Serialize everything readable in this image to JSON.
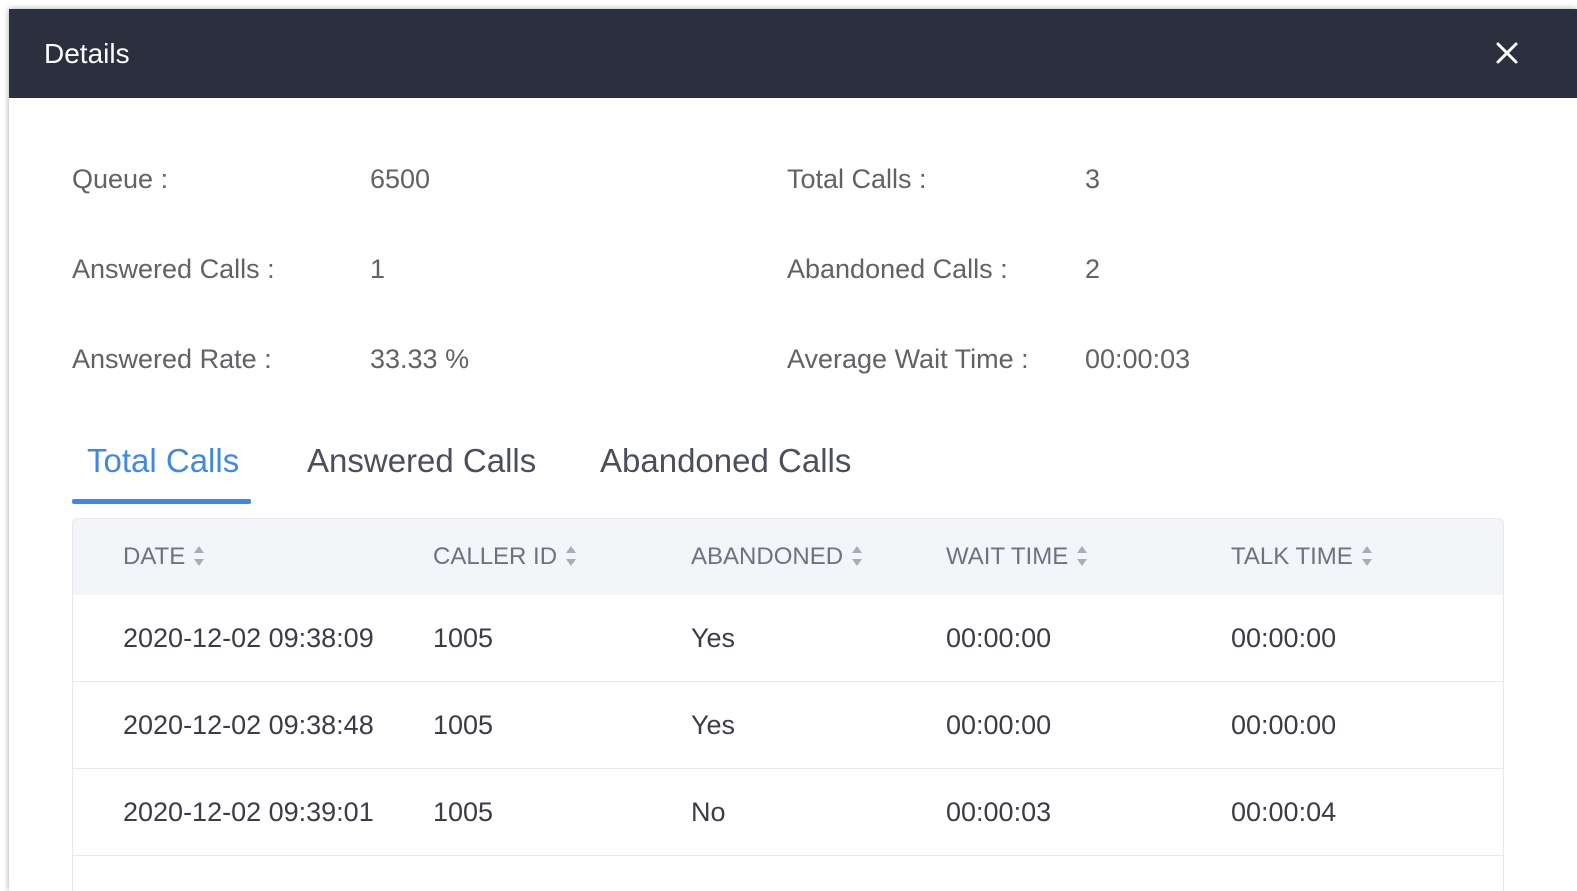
{
  "dialog": {
    "title": "Details",
    "close_icon": "close-icon"
  },
  "summary": {
    "queue_label": "Queue :",
    "queue_value": "6500",
    "total_calls_label": "Total Calls :",
    "total_calls_value": "3",
    "answered_calls_label": "Answered Calls :",
    "answered_calls_value": "1",
    "abandoned_calls_label": "Abandoned Calls :",
    "abandoned_calls_value": "2",
    "answered_rate_label": "Answered Rate :",
    "answered_rate_value": "33.33 %",
    "avg_wait_label": "Average Wait Time :",
    "avg_wait_value": "00:00:03"
  },
  "tabs": [
    {
      "label": "Total Calls",
      "active": true
    },
    {
      "label": "Answered Calls",
      "active": false
    },
    {
      "label": "Abandoned Calls",
      "active": false
    }
  ],
  "table": {
    "columns": [
      "DATE",
      "CALLER ID",
      "ABANDONED",
      "WAIT TIME",
      "TALK TIME"
    ],
    "rows": [
      [
        "2020-12-02 09:38:09",
        "1005",
        "Yes",
        "00:00:00",
        "00:00:00"
      ],
      [
        "2020-12-02 09:38:48",
        "1005",
        "Yes",
        "00:00:00",
        "00:00:00"
      ],
      [
        "2020-12-02 09:39:01",
        "1005",
        "No",
        "00:00:03",
        "00:00:04"
      ]
    ],
    "sort_icon": "sort-icon"
  },
  "colors": {
    "titlebar": "#2c2f3d",
    "accent": "#3f8ae0",
    "header_bg": "#f3f5f8"
  }
}
